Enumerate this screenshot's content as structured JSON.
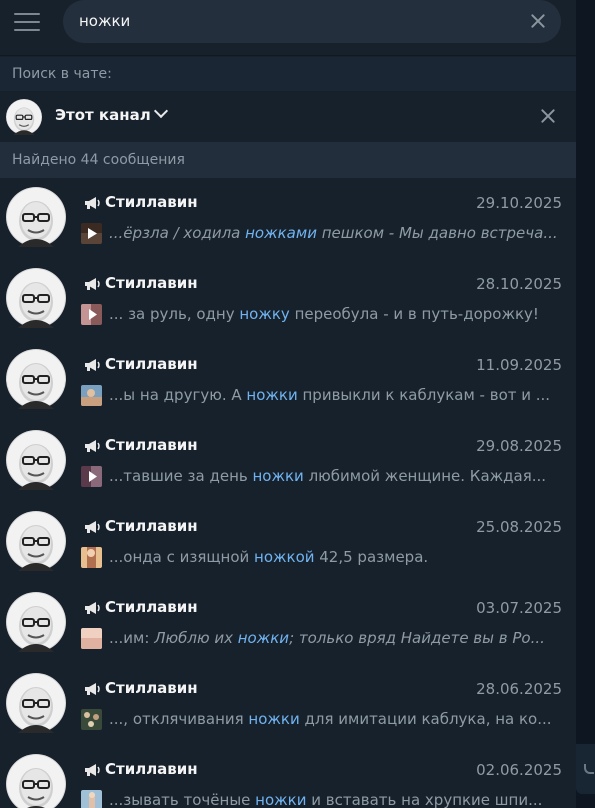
{
  "search": {
    "value": "ножки"
  },
  "search_in_label": "Поиск в чате:",
  "scope": {
    "label": "Этот канал"
  },
  "found_label": "Найдено 44 сообщения",
  "results": [
    {
      "name": "Стиллавин",
      "date": "29.10.2025",
      "italic": true,
      "thumb": "video",
      "before": "...ёрзла / ходила ",
      "match": "ножками",
      "after": " пешком - Мы давно встреча..."
    },
    {
      "name": "Стиллавин",
      "date": "28.10.2025",
      "italic": false,
      "thumb": "video2",
      "before": "... за руль, одну ",
      "match": "ножку",
      "after": " переобула - и в путь-дорожку!"
    },
    {
      "name": "Стиллавин",
      "date": "11.09.2025",
      "italic": false,
      "thumb": "photo1",
      "before": "...ы на другую. А ",
      "match": "ножки",
      "after": " привыкли к каблукам - вот и ..."
    },
    {
      "name": "Стиллавин",
      "date": "29.08.2025",
      "italic": false,
      "thumb": "video3",
      "before": "...тавшие за день ",
      "match": "ножки",
      "after": " любимой женщине.  Каждая..."
    },
    {
      "name": "Стиллавин",
      "date": "25.08.2025",
      "italic": false,
      "thumb": "photo2",
      "before": "...онда с изящной ",
      "match": "ножкой",
      "after": " 42,5 размера."
    },
    {
      "name": "Стиллавин",
      "date": "03.07.2025",
      "italic": false,
      "thumb": "photo3",
      "before": "...им:   ",
      "match": "ножки",
      "after": "; только вряд Найдете вы в Ро...",
      "before_italic": "Люблю их "
    },
    {
      "name": "Стиллавин",
      "date": "28.06.2025",
      "italic": false,
      "thumb": "photo4",
      "before": "..., отклячивания ",
      "match": "ножки",
      "after": " для имитации каблука, на ко..."
    },
    {
      "name": "Стиллавин",
      "date": "02.06.2025",
      "italic": false,
      "thumb": "photo5",
      "before": "...зывать точёные ",
      "match": "ножки",
      "after": " и вставать на хрупкие шпи..."
    }
  ],
  "colors": {
    "background": "#17212b",
    "highlight": "#70b3f0",
    "muted": "#8e9ba6",
    "found_bar": "#232e3c"
  },
  "icons": {
    "menu": "hamburger-icon",
    "clear": "close-icon",
    "channel": "megaphone-icon",
    "dropdown": "chevron-down-icon"
  }
}
